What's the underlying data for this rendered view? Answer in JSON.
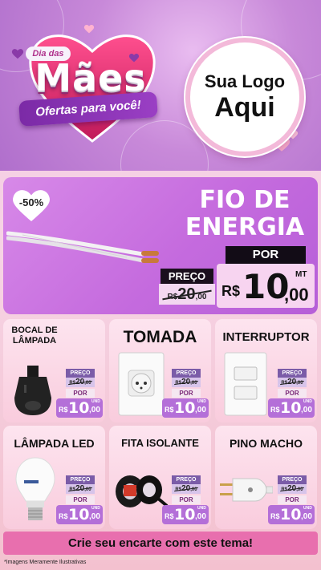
{
  "header": {
    "badge": "Dia das",
    "title": "Mães",
    "ribbon": "Ofertas para você!",
    "logo_line1": "Sua Logo",
    "logo_line2": "Aqui"
  },
  "featured": {
    "discount": "-50%",
    "name_line1": "FIO DE",
    "name_line2": "ENERGIA",
    "preco_label": "PREÇO",
    "old_currency": "R$",
    "old_int": "20",
    "old_dec": ",00",
    "por_label": "POR",
    "currency": "R$",
    "price_int": "10",
    "price_dec": ",00",
    "unit": "MT"
  },
  "products": [
    {
      "name": "BOCAL DE LÂMPADA",
      "preco_label": "PREÇO",
      "old_currency": "R$",
      "old_int": "20",
      "old_dec": ",00",
      "por_label": "POR",
      "currency": "R$",
      "price_int": "10",
      "price_dec": ",00",
      "unit": "UND"
    },
    {
      "name": "TOMADA",
      "preco_label": "PREÇO",
      "old_currency": "R$",
      "old_int": "20",
      "old_dec": ",00",
      "por_label": "POR",
      "currency": "R$",
      "price_int": "10",
      "price_dec": ",00",
      "unit": "UND"
    },
    {
      "name": "INTERRUPTOR",
      "preco_label": "PREÇO",
      "old_currency": "R$",
      "old_int": "20",
      "old_dec": ",00",
      "por_label": "POR",
      "currency": "R$",
      "price_int": "10",
      "price_dec": ",00",
      "unit": "UND"
    },
    {
      "name": "LÂMPADA LED",
      "preco_label": "PREÇO",
      "old_currency": "R$",
      "old_int": "20",
      "old_dec": ",00",
      "por_label": "POR",
      "currency": "R$",
      "price_int": "10",
      "price_dec": ",00",
      "unit": "UND"
    },
    {
      "name": "FITA ISOLANTE",
      "preco_label": "PREÇO",
      "old_currency": "R$",
      "old_int": "20",
      "old_dec": ",00",
      "por_label": "POR",
      "currency": "R$",
      "price_int": "10",
      "price_dec": ",00",
      "unit": "UND"
    },
    {
      "name": "PINO MACHO",
      "preco_label": "PREÇO",
      "old_currency": "R$",
      "old_int": "20",
      "old_dec": ",00",
      "por_label": "POR",
      "currency": "R$",
      "price_int": "10",
      "price_dec": ",00",
      "unit": "UND"
    }
  ],
  "cta": "Crie seu encarte com este tema!",
  "disclaimer": "*Imagens Meramente Ilustrativas",
  "colors": {
    "header_purple": "#c889d9",
    "featured_purple": "#c56bde",
    "card_pink": "#f9ccdd",
    "price_purple": "#b46fd8",
    "cta_pink": "#e86fae"
  }
}
